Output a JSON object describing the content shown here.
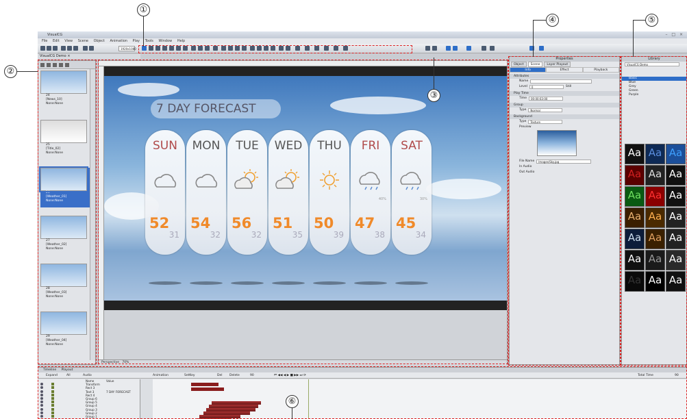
{
  "callouts": [
    "①",
    "②",
    "③",
    "④",
    "⑤",
    "⑥"
  ],
  "app": {
    "title": "VisualCG",
    "window_controls": "– □ ×"
  },
  "menu": [
    "File",
    "Edit",
    "View",
    "Scene",
    "Object",
    "Animation",
    "Play",
    "Tools",
    "Window",
    "Help"
  ],
  "toolbar": {
    "zoom": "1920x1080"
  },
  "document_tab": "VisualCG Demo ×",
  "thumbnails": [
    {
      "id": "24",
      "name": "[News_10]",
      "count": "0",
      "transition": "None:None",
      "selected": false
    },
    {
      "id": "25",
      "name": "[Title_02]",
      "count": "0",
      "transition": "None:None",
      "selected": false
    },
    {
      "id": "26",
      "name": "[Weather_01]",
      "count": "0",
      "transition": "None:None",
      "selected": true
    },
    {
      "id": "27",
      "name": "[Weather_02]",
      "count": "0",
      "transition": "None:None",
      "selected": false
    },
    {
      "id": "28",
      "name": "[Weather_03]",
      "count": "0",
      "transition": "None:None",
      "selected": false
    },
    {
      "id": "29",
      "name": "[Weather_04]",
      "count": "0",
      "transition": "None:None",
      "selected": false
    }
  ],
  "canvas": {
    "heading": "7 DAY FORECAST",
    "view_mode": "Perspective",
    "zoom": "70%",
    "days": [
      {
        "day": "SUN",
        "high": "52",
        "low": "31",
        "icon": "cloud",
        "pct": "",
        "red": true
      },
      {
        "day": "MON",
        "high": "54",
        "low": "32",
        "icon": "cloud",
        "pct": "",
        "red": false
      },
      {
        "day": "TUE",
        "high": "56",
        "low": "32",
        "icon": "sun-cloud",
        "pct": "",
        "red": false
      },
      {
        "day": "WED",
        "high": "51",
        "low": "35",
        "icon": "sun-cloud",
        "pct": "",
        "red": false
      },
      {
        "day": "THU",
        "high": "50",
        "low": "39",
        "icon": "sun",
        "pct": "",
        "red": false
      },
      {
        "day": "FRI",
        "high": "47",
        "low": "38",
        "icon": "rain",
        "pct": "40%",
        "red": true
      },
      {
        "day": "SAT",
        "high": "45",
        "low": "34",
        "icon": "rain",
        "pct": "30%",
        "red": true
      }
    ]
  },
  "properties": {
    "title": "Properties",
    "tabs": [
      "Object",
      "Scene",
      "Layer Playout"
    ],
    "subtabs": [
      "Info",
      "Effect",
      "Playback"
    ],
    "sections": {
      "attributes": "Attributes",
      "name_label": "Name",
      "level_label": "Level",
      "level_value": "0",
      "still_label": "Still",
      "play_time": "Play Time",
      "time_label": "Time",
      "time_value": "00:00:03:00",
      "group": "Group",
      "type_label": "Type",
      "type_value": "Normal",
      "background": "Background",
      "bg_type_value": "Texture",
      "preview_label": "Preview",
      "file_label": "File Name",
      "file_value": "Images/Sky.jpg",
      "in_audio": "In Audio",
      "out_audio": "Out Audio"
    }
  },
  "library": {
    "title": "Library",
    "dropdown": "VisualCG Demo",
    "tree": [
      "Basic",
      "Blue",
      "Grey",
      "Green",
      "Purple"
    ],
    "tiles": [
      "Aa",
      "Aa",
      "Aa",
      "Aa",
      "Aa",
      "Aa",
      "Aa",
      "Aa",
      "Aa",
      "Aa",
      "Aa",
      "Aa",
      "Aa",
      "Aa",
      "Aa",
      "Aa",
      "Aa",
      "Aa",
      "Aa",
      "Aa",
      "Aa"
    ]
  },
  "timeline": {
    "tabs": [
      "Timeline",
      "Playout"
    ],
    "expand": "Expand",
    "filter_all": "All",
    "filter_audio": "Audio",
    "animation": "Animation",
    "setkey": "SetKey",
    "del": "Del",
    "delete": "Delete",
    "frame": "90",
    "total_time_label": "Total Time",
    "total_time": "90",
    "col_name": "Name",
    "col_value": "Value",
    "layers": [
      {
        "name": "Transform",
        "value": ""
      },
      {
        "name": "Rect 3",
        "value": ""
      },
      {
        "name": "Text 3",
        "value": "7 DAY FORECAST"
      },
      {
        "name": "Rect 4",
        "value": ""
      },
      {
        "name": "Group 6",
        "value": ""
      },
      {
        "name": "Group 5",
        "value": ""
      },
      {
        "name": "Group 4",
        "value": ""
      },
      {
        "name": "Group 3",
        "value": ""
      },
      {
        "name": "Group 2",
        "value": ""
      },
      {
        "name": "Group 1",
        "value": ""
      },
      {
        "name": "Group 7",
        "value": ""
      }
    ]
  }
}
